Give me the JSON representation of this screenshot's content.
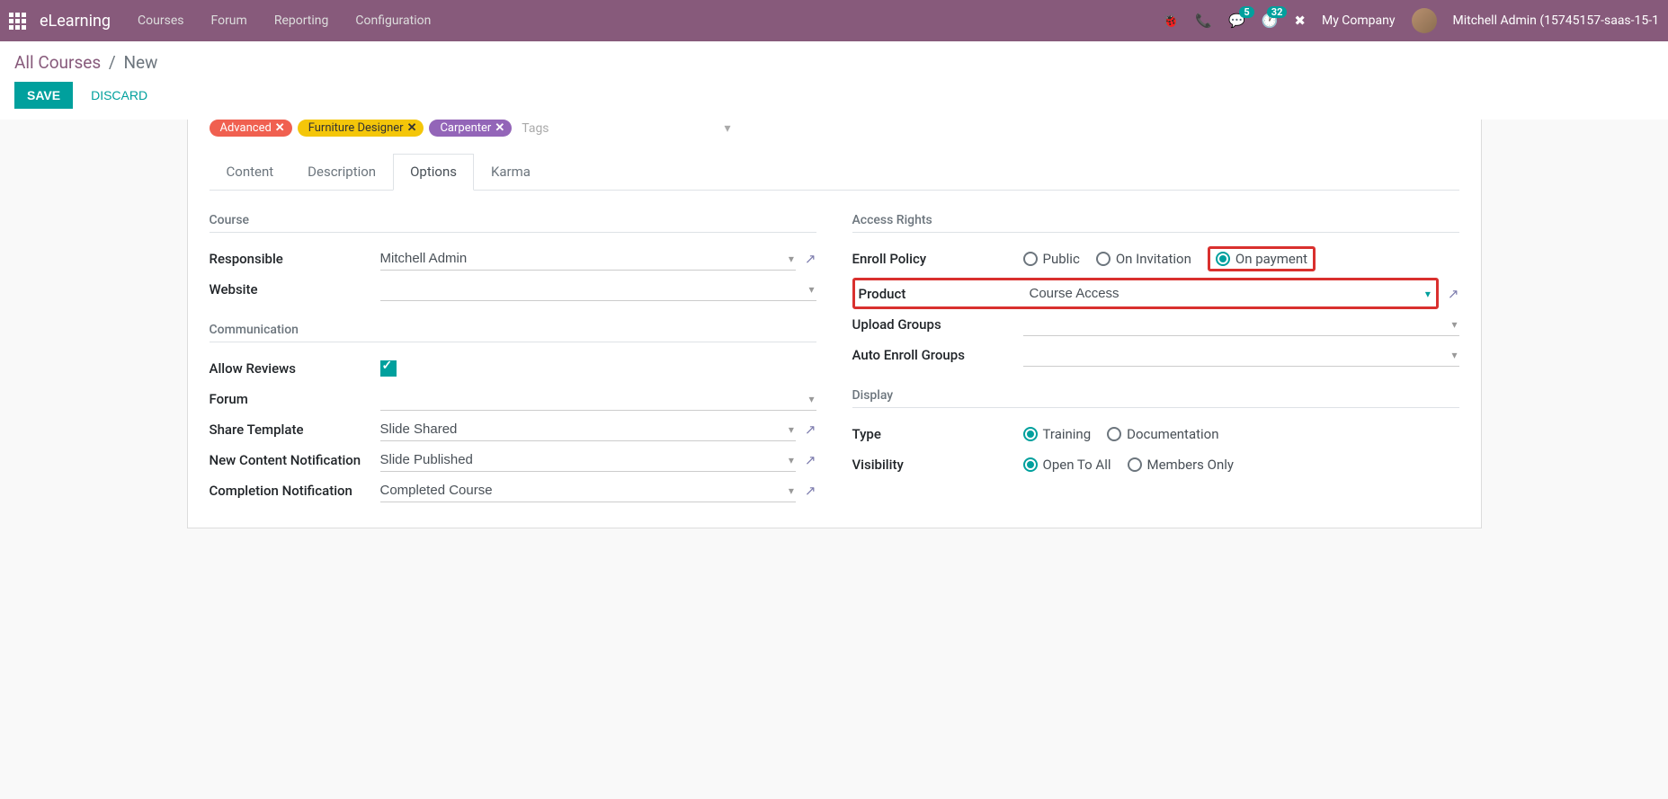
{
  "brand": "eLearning",
  "nav": {
    "courses": "Courses",
    "forum": "Forum",
    "reporting": "Reporting",
    "configuration": "Configuration"
  },
  "header": {
    "company": "My Company",
    "user": "Mitchell Admin (15745157-saas-15-1",
    "msg_badge": "5",
    "act_badge": "32"
  },
  "breadcrumb": {
    "root": "All Courses",
    "current": "New"
  },
  "buttons": {
    "save": "SAVE",
    "discard": "DISCARD"
  },
  "tags": {
    "t1": "Advanced",
    "t2": "Furniture Designer",
    "t3": "Carpenter",
    "placeholder": "Tags"
  },
  "tabs": {
    "content": "Content",
    "description": "Description",
    "options": "Options",
    "karma": "Karma"
  },
  "sections": {
    "course": "Course",
    "communication": "Communication",
    "access": "Access Rights",
    "display": "Display"
  },
  "fields": {
    "responsible_label": "Responsible",
    "responsible_value": "Mitchell Admin",
    "website_label": "Website",
    "website_value": "",
    "allow_reviews_label": "Allow Reviews",
    "forum_label": "Forum",
    "forum_value": "",
    "share_template_label": "Share Template",
    "share_template_value": "Slide Shared",
    "new_content_label": "New Content Notification",
    "new_content_value": "Slide Published",
    "completion_label": "Completion Notification",
    "completion_value": "Completed Course",
    "enroll_label": "Enroll Policy",
    "product_label": "Product",
    "product_value": "Course Access",
    "upload_groups_label": "Upload Groups",
    "upload_groups_value": "",
    "auto_enroll_label": "Auto Enroll Groups",
    "auto_enroll_value": "",
    "type_label": "Type",
    "visibility_label": "Visibility"
  },
  "radios": {
    "enroll_public": "Public",
    "enroll_invitation": "On Invitation",
    "enroll_payment": "On payment",
    "type_training": "Training",
    "type_doc": "Documentation",
    "vis_open": "Open To All",
    "vis_members": "Members Only"
  }
}
